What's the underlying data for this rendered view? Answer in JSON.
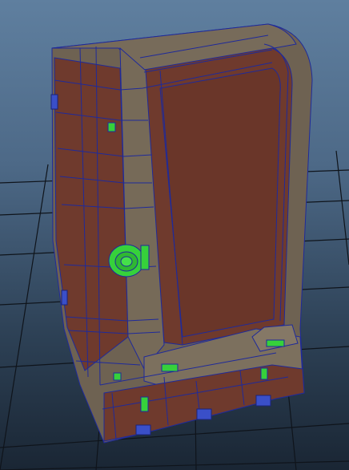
{
  "viewport": {
    "background_top": "#5f7f9f",
    "background_bottom": "#1a2634",
    "grid_color": "#0f141b"
  },
  "model": {
    "wireframe_color": "#1f2a9a",
    "frame_color": "#6e6252",
    "panel_color": "#6f3a2d",
    "selected_parts_color": "#36d13b",
    "connector_icon": "coaxial-connector-icon"
  }
}
